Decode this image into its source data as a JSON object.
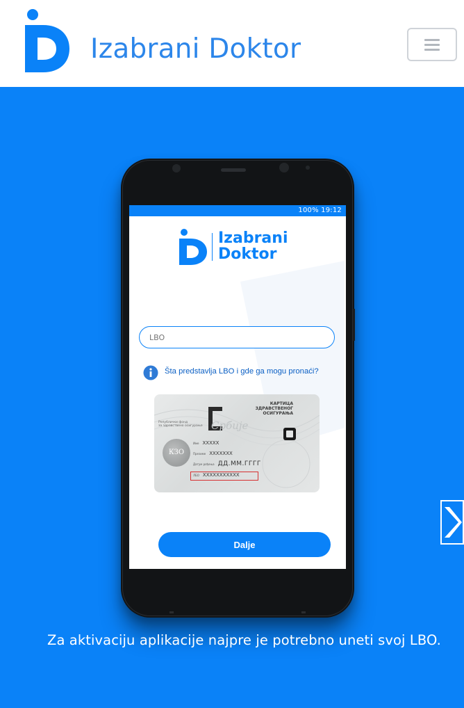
{
  "header": {
    "brand_name": "Izabrani Doktor",
    "menu_icon": "hamburger-menu-icon"
  },
  "colors": {
    "brand_blue": "#0a82f8",
    "brand_text": "#2c86ea",
    "white": "#ffffff"
  },
  "hero": {
    "next_slide_icon": "chevron-right-icon",
    "caption": "Za aktivaciju aplikacije najpre je potrebno uneti svoj LBO."
  },
  "phone_screen": {
    "status_text": "100% 19:12",
    "app_name_line1": "Izabrani",
    "app_name_line2": "Doktor",
    "lbo_placeholder": "LBO",
    "info_question": "Šta predstavlja LBO i gde ga mogu pronaći?",
    "submit_label": "Dalje",
    "card": {
      "title_line1": "КАРТИЦА",
      "title_line2": "ЗДРАВСТВЕНОГ",
      "title_line3": "ОСИГУРАЊА",
      "country": "Србије",
      "fund_line1": "Републички фонд",
      "fund_line2": "за здравствено осигурање",
      "seal": "КЗО",
      "name_label": "Име",
      "name_value": "XXXXX",
      "surname_label": "Презиме",
      "surname_value": "XXXXXXX",
      "dob_label": "Датум рођења",
      "dob_value": "ДД.ММ.ГГГГ",
      "lbo_label": "ЛБО",
      "lbo_value": "XXXXXXXXXXX"
    }
  }
}
